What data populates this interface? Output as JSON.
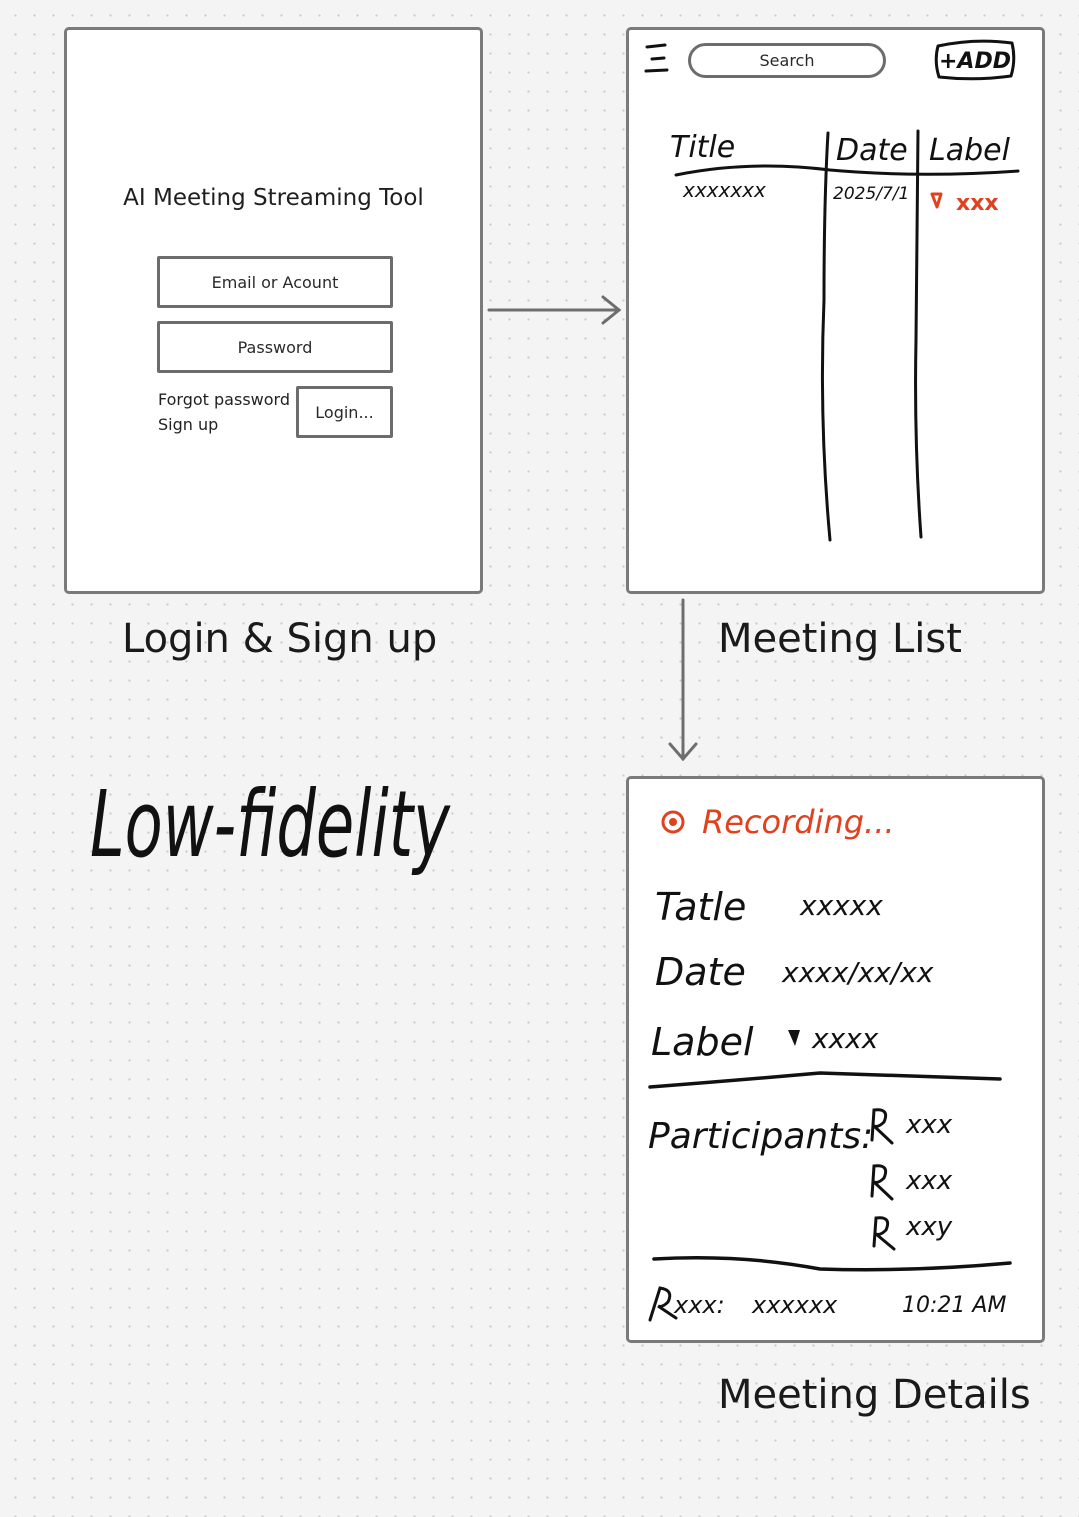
{
  "login_screen": {
    "app_title": "AI Meeting Streaming Tool",
    "email_placeholder": "Email or Acount",
    "password_placeholder": "Password",
    "forgot_password": "Forgot password",
    "sign_up": "Sign up",
    "login_button": "Login...",
    "caption": "Login & Sign up"
  },
  "meeting_list_screen": {
    "search_placeholder": "Search",
    "add_button": "+ADD",
    "columns": [
      "Title",
      "Date",
      "Label"
    ],
    "rows": [
      {
        "title": "xxxxxxx",
        "date": "2025/7/1",
        "label": "xxx"
      }
    ],
    "caption": "Meeting List"
  },
  "meeting_details_screen": {
    "recording": "Recording...",
    "fields": [
      {
        "label": "Tatle",
        "value": "xxxxx"
      },
      {
        "label": "Date",
        "value": "xxxx/xx/xx"
      },
      {
        "label": "Label",
        "value": "xxxx"
      }
    ],
    "participants_label": "Participants:",
    "participants": [
      "xxx",
      "xxx",
      "xxy"
    ],
    "transcript": {
      "speaker": "xxx:",
      "text": "xxxxxx",
      "time": "10:21 AM"
    },
    "caption": "Meeting Details"
  },
  "annotation": "Low-fidelity",
  "colors": {
    "frame_border": "#7a7a7a",
    "ink": "#111111",
    "recording_red": "#e0411f",
    "background": "#f4f4f4"
  }
}
